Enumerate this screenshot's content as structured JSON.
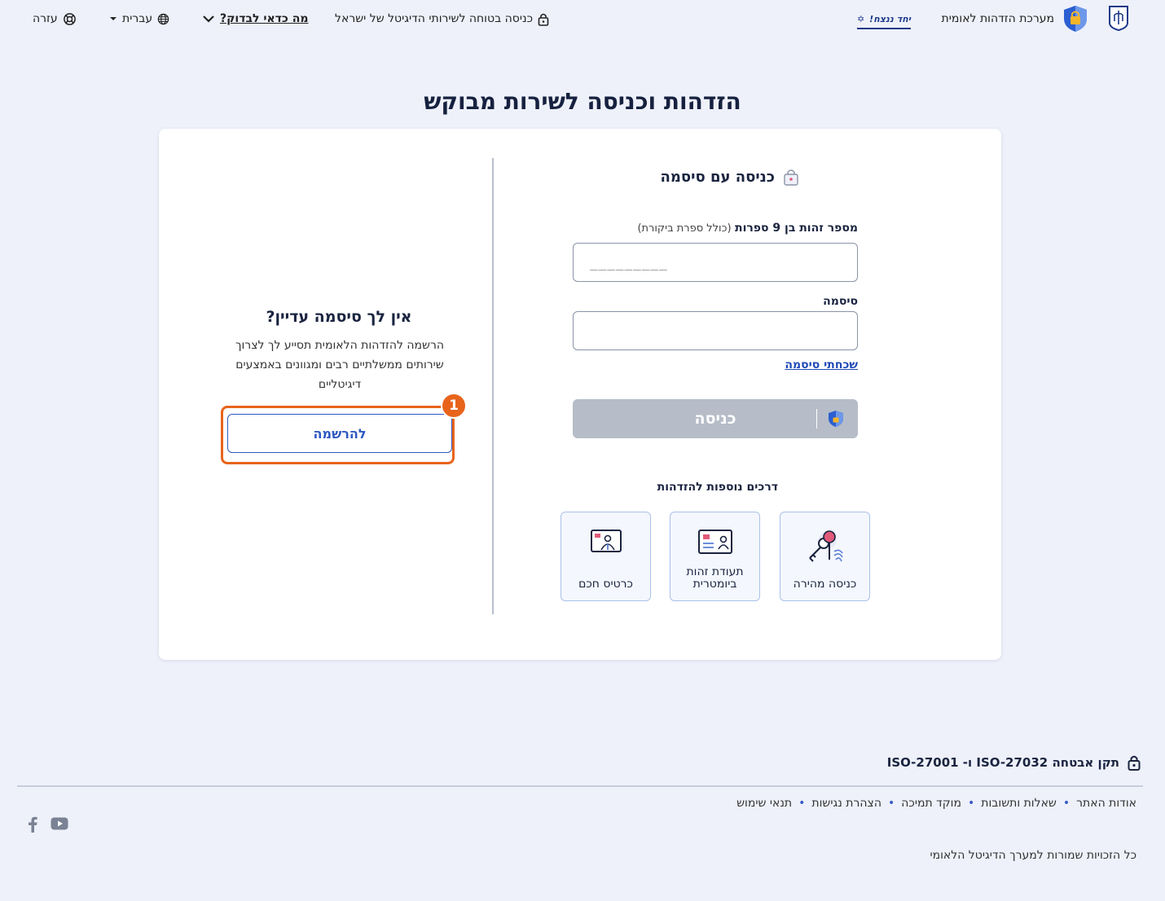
{
  "header": {
    "system_name": "מערכת הזדהות לאומית",
    "yahad": "יחד ננצח!",
    "secure_entry": "כניסה בטוחה לשירותי הדיגיטל של ישראל",
    "why_check": "מה כדאי לבדוק?",
    "language": "עברית",
    "help": "עזרה"
  },
  "page": {
    "title": "הזדהות וכניסה לשירות מבוקש"
  },
  "login": {
    "title": "כניסה עם סיסמה",
    "id_label_bold": "מספר זהות בן 9 ספרות",
    "id_label_hint": "(כולל ספרת ביקורת)",
    "id_placeholder": "_________",
    "password_label": "סיסמה",
    "forgot_password": "שכחתי סיסמה",
    "enter_button": "כניסה",
    "more_ways_title": "דרכים נוספות להזדהות",
    "ways": [
      {
        "label": "כניסה מהירה",
        "icon": "fingerprint-key-icon"
      },
      {
        "label": "תעודת זהות ביומטרית",
        "icon": "id-card-icon"
      },
      {
        "label": "כרטיס חכם",
        "icon": "smart-card-icon"
      }
    ]
  },
  "register": {
    "title": "אין לך סיסמה עדיין?",
    "text": "הרשמה להזדהות הלאומית תסייע לך לצרוך שירותים ממשלתיים רבים ומגוונים באמצעים דיגיטליים",
    "button": "להרשמה",
    "badge": "1"
  },
  "footer": {
    "iso": "תקן אבטחה ISO-27032 ו- ISO-27001",
    "links": [
      "אודות האתר",
      "שאלות ותשובות",
      "מוקד תמיכה",
      "הצהרת נגישות",
      "תנאי שימוש"
    ],
    "copyright": "כל הזכויות שמורות למערך הדיגיטל הלאומי"
  },
  "colors": {
    "accent": "#1f49b6",
    "highlight": "#e8641c",
    "disabled_button": "#b6bdc8",
    "background": "#eef1fa"
  }
}
